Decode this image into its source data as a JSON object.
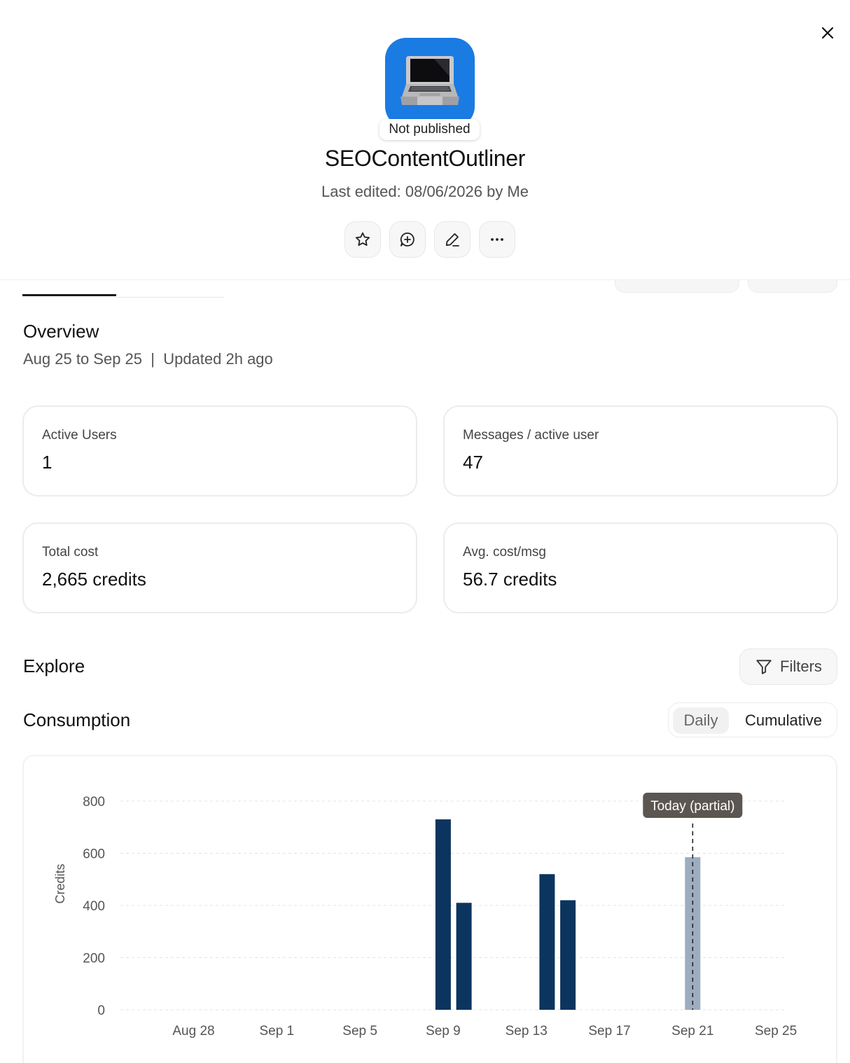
{
  "app": {
    "name": "SEOContentOutliner",
    "status_badge": "Not published",
    "last_edited": "Last edited: 08/06/2026 by Me",
    "icon": "laptop-emoji"
  },
  "actions": {
    "star": "star-icon",
    "chat": "chat-plus-icon",
    "edit": "pencil-icon",
    "more": "more-horizontal-icon",
    "close": "close-icon"
  },
  "overview": {
    "title": "Overview",
    "subtitle": "Aug 25 to Sep 25  |  Updated 2h ago",
    "cards": [
      {
        "label": "Active Users",
        "value": "1"
      },
      {
        "label": "Messages / active user",
        "value": "47"
      },
      {
        "label": "Total cost",
        "value": "2,665 credits"
      },
      {
        "label": "Avg. cost/msg",
        "value": "56.7 credits"
      }
    ]
  },
  "explore": {
    "title": "Explore",
    "filters_label": "Filters"
  },
  "consumption": {
    "title": "Consumption",
    "toggle": {
      "daily": "Daily",
      "cumulative": "Cumulative",
      "selected": "Daily"
    }
  },
  "chart_data": {
    "type": "bar",
    "ylabel": "Credits",
    "ylim": [
      0,
      800
    ],
    "yticks": [
      0,
      200,
      400,
      600,
      800
    ],
    "xticks": [
      "Aug 28",
      "Sep 1",
      "Sep 5",
      "Sep 9",
      "Sep 13",
      "Sep 17",
      "Sep 21",
      "Sep 25"
    ],
    "grid": true,
    "today_marker": {
      "label": "Today (partial)",
      "date": "Sep 21"
    },
    "bars": [
      {
        "date": "Sep 9",
        "value": 730,
        "partial": false
      },
      {
        "date": "Sep 10",
        "value": 410,
        "partial": false
      },
      {
        "date": "Sep 14",
        "value": 520,
        "partial": false
      },
      {
        "date": "Sep 15",
        "value": 420,
        "partial": false
      },
      {
        "date": "Sep 21",
        "value": 585,
        "partial": true
      }
    ],
    "colors": {
      "bar": "#0b355e",
      "partial_bar": "#9dadc0",
      "grid": "#e3e3e3"
    }
  }
}
